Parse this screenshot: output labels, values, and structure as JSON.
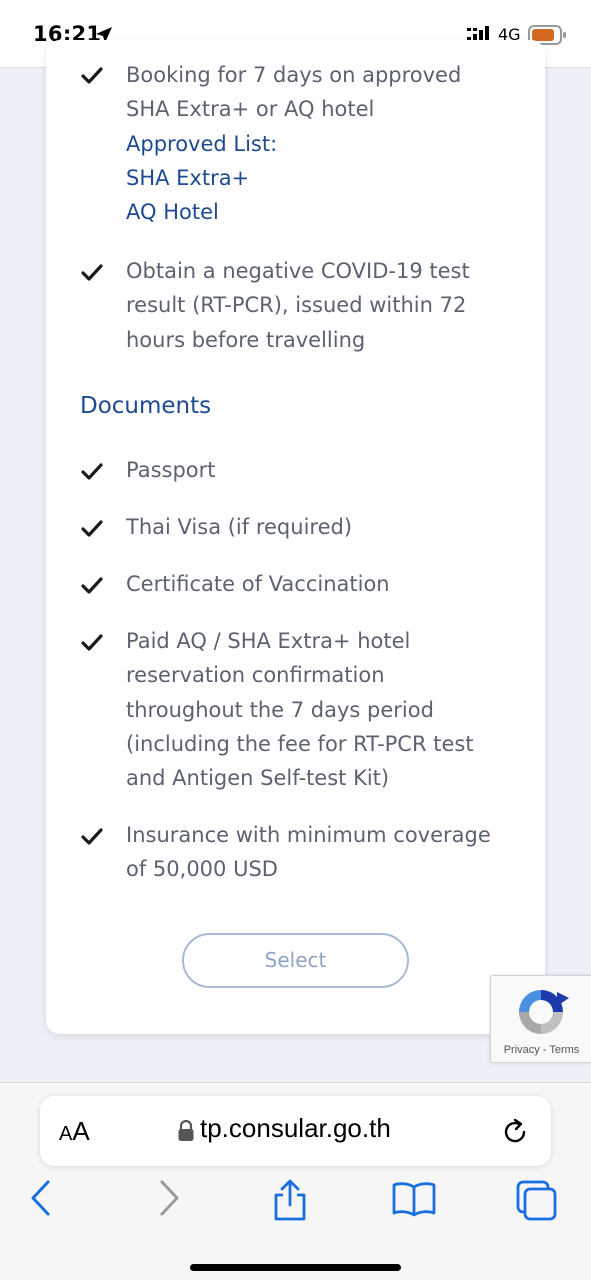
{
  "status_bar": {
    "time": "16:21",
    "network": "4G",
    "battery_color": "#d2691e",
    "icons": [
      "location-arrow-icon",
      "signal-icon",
      "battery-icon"
    ]
  },
  "requirements": [
    {
      "lines": [
        "Booking for 7 days on approved",
        "SHA Extra+ or AQ hotel"
      ],
      "links": [
        "Approved List:",
        "SHA Extra+",
        "AQ Hotel"
      ]
    },
    {
      "lines": [
        "Obtain a negative COVID-19 test",
        "result (RT-PCR), issued within 72",
        "hours before travelling"
      ]
    }
  ],
  "documents": {
    "title": "Documents",
    "items": [
      {
        "lines": [
          "Passport"
        ]
      },
      {
        "lines": [
          "Thai Visa (if required)"
        ]
      },
      {
        "lines": [
          "Certificate of Vaccination"
        ]
      },
      {
        "lines": [
          "Paid AQ / SHA Extra+ hotel",
          "reservation confirmation",
          "throughout the 7 days period",
          "(including the fee for RT-PCR test",
          "and Antigen Self-test Kit)"
        ]
      },
      {
        "lines": [
          "Insurance with minimum coverage",
          "of 50,000 USD"
        ]
      }
    ]
  },
  "select_button": "Select",
  "recaptcha": {
    "privacy": "Privacy",
    "separator": " - ",
    "terms": "Terms"
  },
  "browser": {
    "aa_small": "A",
    "aa_big": "A",
    "url": "tp.consular.go.th",
    "icons": [
      "back-icon",
      "forward-icon",
      "share-icon",
      "bookmarks-icon",
      "tabs-icon",
      "reload-icon",
      "lock-icon"
    ]
  },
  "colors": {
    "link": "#1d4a93",
    "text": "#5c6270",
    "background": "#edf1f7"
  }
}
